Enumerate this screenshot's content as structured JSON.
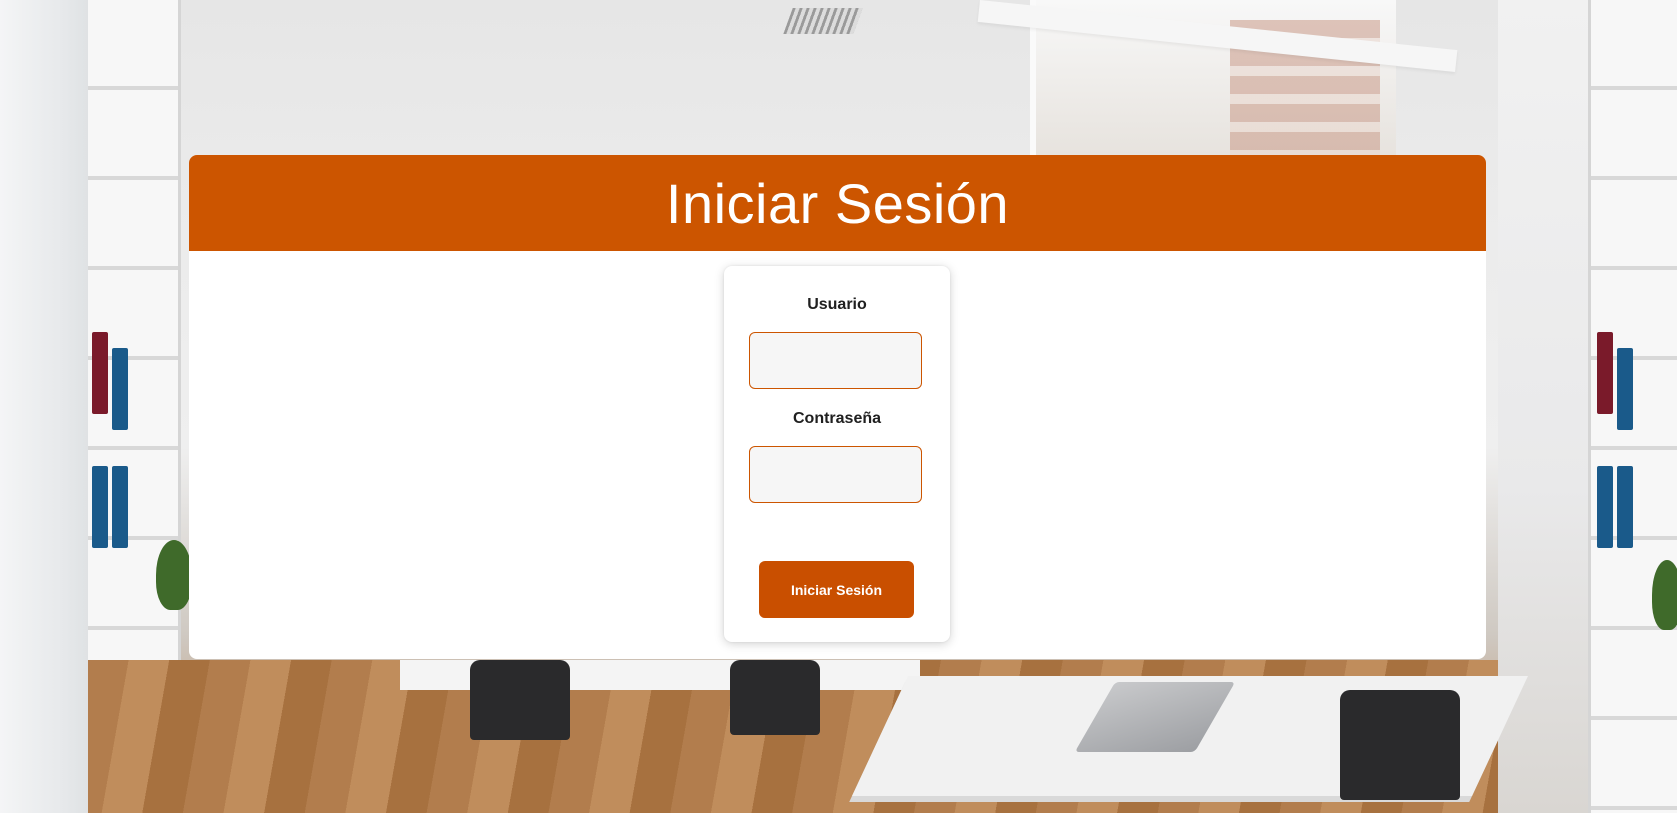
{
  "header": {
    "title": "Iniciar Sesión"
  },
  "login_form": {
    "username": {
      "label": "Usuario",
      "value": ""
    },
    "password": {
      "label": "Contraseña",
      "value": ""
    },
    "submit_label": "Iniciar Sesión"
  },
  "colors": {
    "accent": "#cc5500",
    "button": "#c94f00",
    "panel_background": "#ffffff",
    "input_background": "#f6f6f6"
  }
}
